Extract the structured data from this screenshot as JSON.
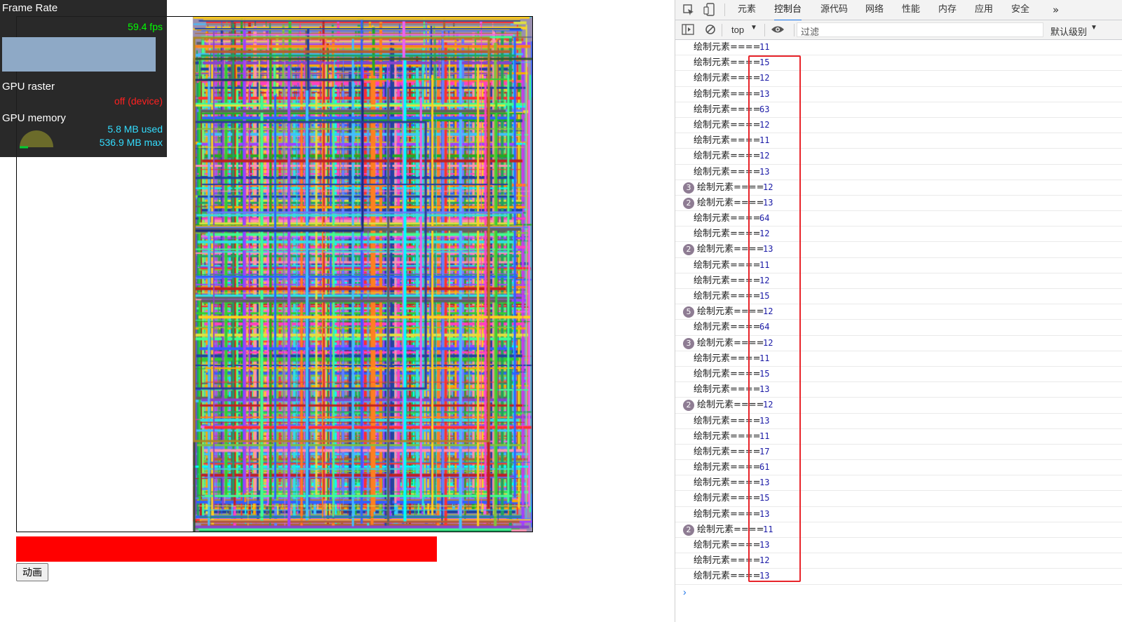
{
  "fps_meter": {
    "title": "Frame Rate",
    "fps": "59.4 fps",
    "gpu_raster_label": "GPU raster",
    "gpu_raster_status": "off (device)",
    "gpu_memory_label": "GPU memory",
    "memory_used": "5.8 MB used",
    "memory_max": "536.9 MB max"
  },
  "page": {
    "button_label": "动画",
    "red_bar_color": "#ff0000"
  },
  "devtools": {
    "tabs": [
      {
        "label": "元素",
        "active": false
      },
      {
        "label": "控制台",
        "active": true
      },
      {
        "label": "源代码",
        "active": false
      },
      {
        "label": "网络",
        "active": false
      },
      {
        "label": "性能",
        "active": false
      },
      {
        "label": "内存",
        "active": false
      },
      {
        "label": "应用",
        "active": false
      },
      {
        "label": "安全",
        "active": false
      }
    ],
    "more_tabs": "»",
    "context": "top",
    "filter_placeholder": "过滤",
    "level": "默认级别",
    "prompt": "›",
    "log_prefix": "绘制元素====",
    "logs": [
      {
        "count": null,
        "value": "11"
      },
      {
        "count": null,
        "value": "15"
      },
      {
        "count": null,
        "value": "12"
      },
      {
        "count": null,
        "value": "13"
      },
      {
        "count": null,
        "value": "63"
      },
      {
        "count": null,
        "value": "12"
      },
      {
        "count": null,
        "value": "11"
      },
      {
        "count": null,
        "value": "12"
      },
      {
        "count": null,
        "value": "13"
      },
      {
        "count": "3",
        "value": "12"
      },
      {
        "count": "2",
        "value": "13"
      },
      {
        "count": null,
        "value": "64"
      },
      {
        "count": null,
        "value": "12"
      },
      {
        "count": "2",
        "value": "13"
      },
      {
        "count": null,
        "value": "11"
      },
      {
        "count": null,
        "value": "12"
      },
      {
        "count": null,
        "value": "15"
      },
      {
        "count": "5",
        "value": "12"
      },
      {
        "count": null,
        "value": "64"
      },
      {
        "count": "3",
        "value": "12"
      },
      {
        "count": null,
        "value": "11"
      },
      {
        "count": null,
        "value": "15"
      },
      {
        "count": null,
        "value": "13"
      },
      {
        "count": "2",
        "value": "12"
      },
      {
        "count": null,
        "value": "13"
      },
      {
        "count": null,
        "value": "11"
      },
      {
        "count": null,
        "value": "17"
      },
      {
        "count": null,
        "value": "61"
      },
      {
        "count": null,
        "value": "13"
      },
      {
        "count": null,
        "value": "15"
      },
      {
        "count": null,
        "value": "13"
      },
      {
        "count": "2",
        "value": "11"
      },
      {
        "count": null,
        "value": "13"
      },
      {
        "count": null,
        "value": "12"
      },
      {
        "count": null,
        "value": "13"
      }
    ]
  },
  "colors": {
    "fps_green": "#00ff00",
    "raster_red": "#ff2020",
    "memory_cyan": "#33ddff",
    "highlight_red": "#e8242a",
    "badge": "#8e7c93"
  }
}
